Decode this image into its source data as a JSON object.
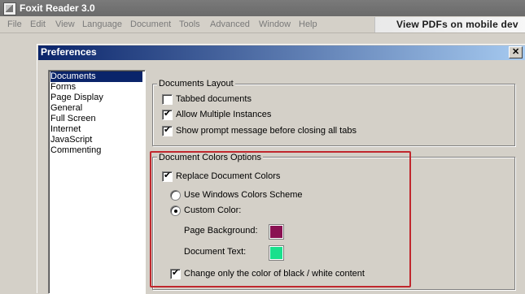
{
  "app": {
    "title": "Foxit Reader 3.0"
  },
  "menu": {
    "items": [
      "File",
      "Edit",
      "View",
      "Language",
      "Document",
      "Tools",
      "Advanced",
      "Window",
      "Help"
    ]
  },
  "banner": {
    "text": "View PDFs on mobile dev"
  },
  "dialog": {
    "title": "Preferences",
    "close_glyph": "✕",
    "categories": [
      "Documents",
      "Forms",
      "Page Display",
      "General",
      "Full Screen",
      "Internet",
      "JavaScript",
      "Commenting"
    ],
    "selected_category": "Documents",
    "layout_group": {
      "title": "Documents Layout",
      "options": [
        {
          "label": "Tabbed documents",
          "checked": false
        },
        {
          "label": "Allow Multiple Instances",
          "checked": true
        },
        {
          "label": "Show prompt message before closing all tabs",
          "checked": true
        }
      ]
    },
    "colors_group": {
      "title": "Document Colors Options",
      "replace_label": "Replace Document Colors",
      "replace_checked": true,
      "windows_scheme_label": "Use Windows Colors Scheme",
      "custom_color_label": "Custom Color:",
      "selected_scheme": "custom",
      "page_background_label": "Page Background:",
      "page_background_color": "#8a1152",
      "document_text_label": "Document Text:",
      "document_text_color": "#19e08c",
      "bw_only_label": "Change only  the color of black / white content",
      "bw_only_checked": true
    }
  },
  "colors": {
    "selection": "#0a246a",
    "highlight_border": "#c0272d"
  }
}
